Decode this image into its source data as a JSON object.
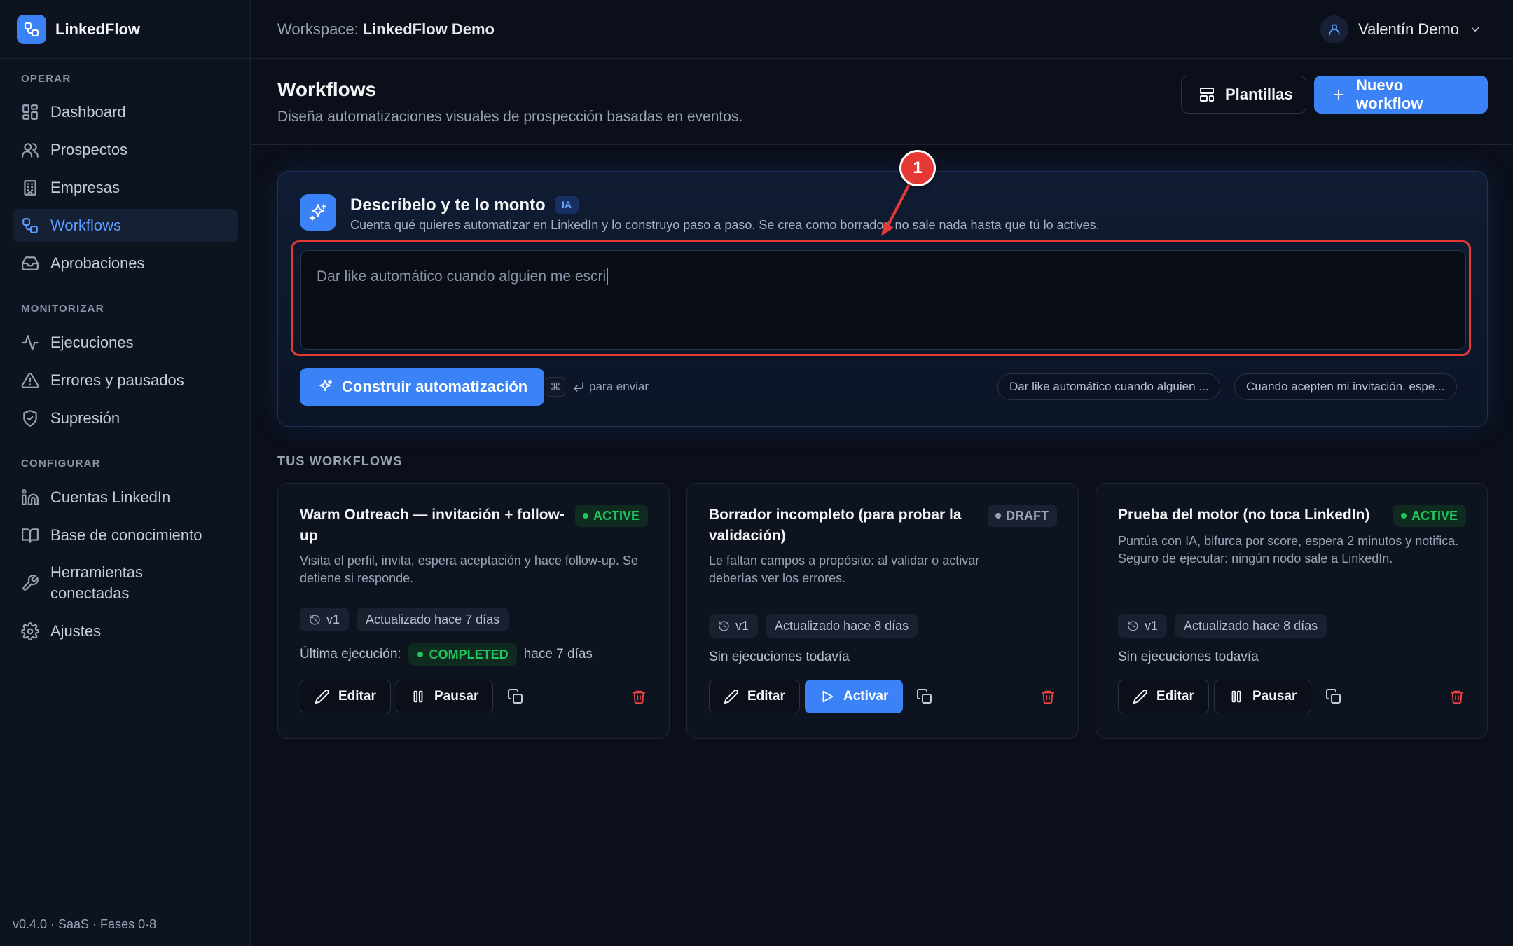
{
  "app": {
    "name": "LinkedFlow"
  },
  "topbar": {
    "workspace_label": "Workspace:",
    "workspace_name": "LinkedFlow Demo",
    "user_name": "Valentín Demo"
  },
  "sidebar": {
    "sections": [
      "OPERAR",
      "MONITORIZAR",
      "CONFIGURAR"
    ],
    "items": [
      {
        "label": "Dashboard",
        "icon": "dashboard-icon"
      },
      {
        "label": "Prospectos",
        "icon": "users-icon"
      },
      {
        "label": "Empresas",
        "icon": "building-icon"
      },
      {
        "label": "Workflows",
        "icon": "workflow-icon",
        "active": true
      },
      {
        "label": "Aprobaciones",
        "icon": "inbox-icon"
      },
      {
        "label": "Ejecuciones",
        "icon": "activity-icon"
      },
      {
        "label": "Errores y pausados",
        "icon": "warning-icon"
      },
      {
        "label": "Supresión",
        "icon": "shield-icon"
      },
      {
        "label": "Cuentas LinkedIn",
        "icon": "linkedin-icon"
      },
      {
        "label": "Base de conocimiento",
        "icon": "book-icon"
      },
      {
        "label": "Herramientas conectadas",
        "icon": "wrench-icon"
      },
      {
        "label": "Ajustes",
        "icon": "gear-icon"
      }
    ],
    "footer": "v0.4.0 · SaaS · Fases 0-8"
  },
  "page": {
    "title": "Workflows",
    "subtitle": "Diseña automatizaciones visuales de prospección basadas en eventos.",
    "templates_label": "Plantillas",
    "new_label": "Nuevo workflow"
  },
  "ai_panel": {
    "title": "Descríbelo y te lo monto",
    "badge": "IA",
    "subtitle": "Cuenta qué quieres automatizar en LinkedIn y lo construyo paso a paso. Se crea como borrador: no sale nada hasta que tú lo actives.",
    "input_value": "Dar like automático cuando alguien me escri",
    "build_label": "Construir automatización",
    "kbd_symbol": "⌘",
    "send_hint": "para enviar",
    "suggestions": [
      "Dar like automático cuando alguien ...",
      "Cuando acepten mi invitación, espe..."
    ]
  },
  "annotation": {
    "number": "1",
    "color": "#e53935"
  },
  "workflows": {
    "section_label": "TUS WORKFLOWS",
    "cards": [
      {
        "title": "Warm Outreach — invitación + follow-up",
        "status": "ACTIVE",
        "description": "Visita el perfil, invita, espera aceptación y hace follow-up. Se detiene si responde.",
        "version": "v1",
        "updated": "Actualizado hace 7 días",
        "last_exec_label": "Última ejecución:",
        "last_exec_status": "COMPLETED",
        "last_exec_time": "hace 7 días",
        "edit_label": "Editar",
        "toggle_label": "Pausar"
      },
      {
        "title": "Borrador incompleto (para probar la validación)",
        "status": "DRAFT",
        "description": "Le faltan campos a propósito: al validar o activar deberías ver los errores.",
        "version": "v1",
        "updated": "Actualizado hace 8 días",
        "no_exec": "Sin ejecuciones todavía",
        "edit_label": "Editar",
        "toggle_label": "Activar"
      },
      {
        "title": "Prueba del motor (no toca LinkedIn)",
        "status": "ACTIVE",
        "description": "Puntúa con IA, bifurca por score, espera 2 minutos y notifica. Seguro de ejecutar: ningún nodo sale a LinkedIn.",
        "version": "v1",
        "updated": "Actualizado hace 8 días",
        "no_exec": "Sin ejecuciones todavía",
        "edit_label": "Editar",
        "toggle_label": "Pausar"
      }
    ]
  },
  "colors": {
    "accent": "#3b82f6",
    "success": "#22c55e",
    "danger": "#ef4444",
    "background": "#0b0f19"
  }
}
